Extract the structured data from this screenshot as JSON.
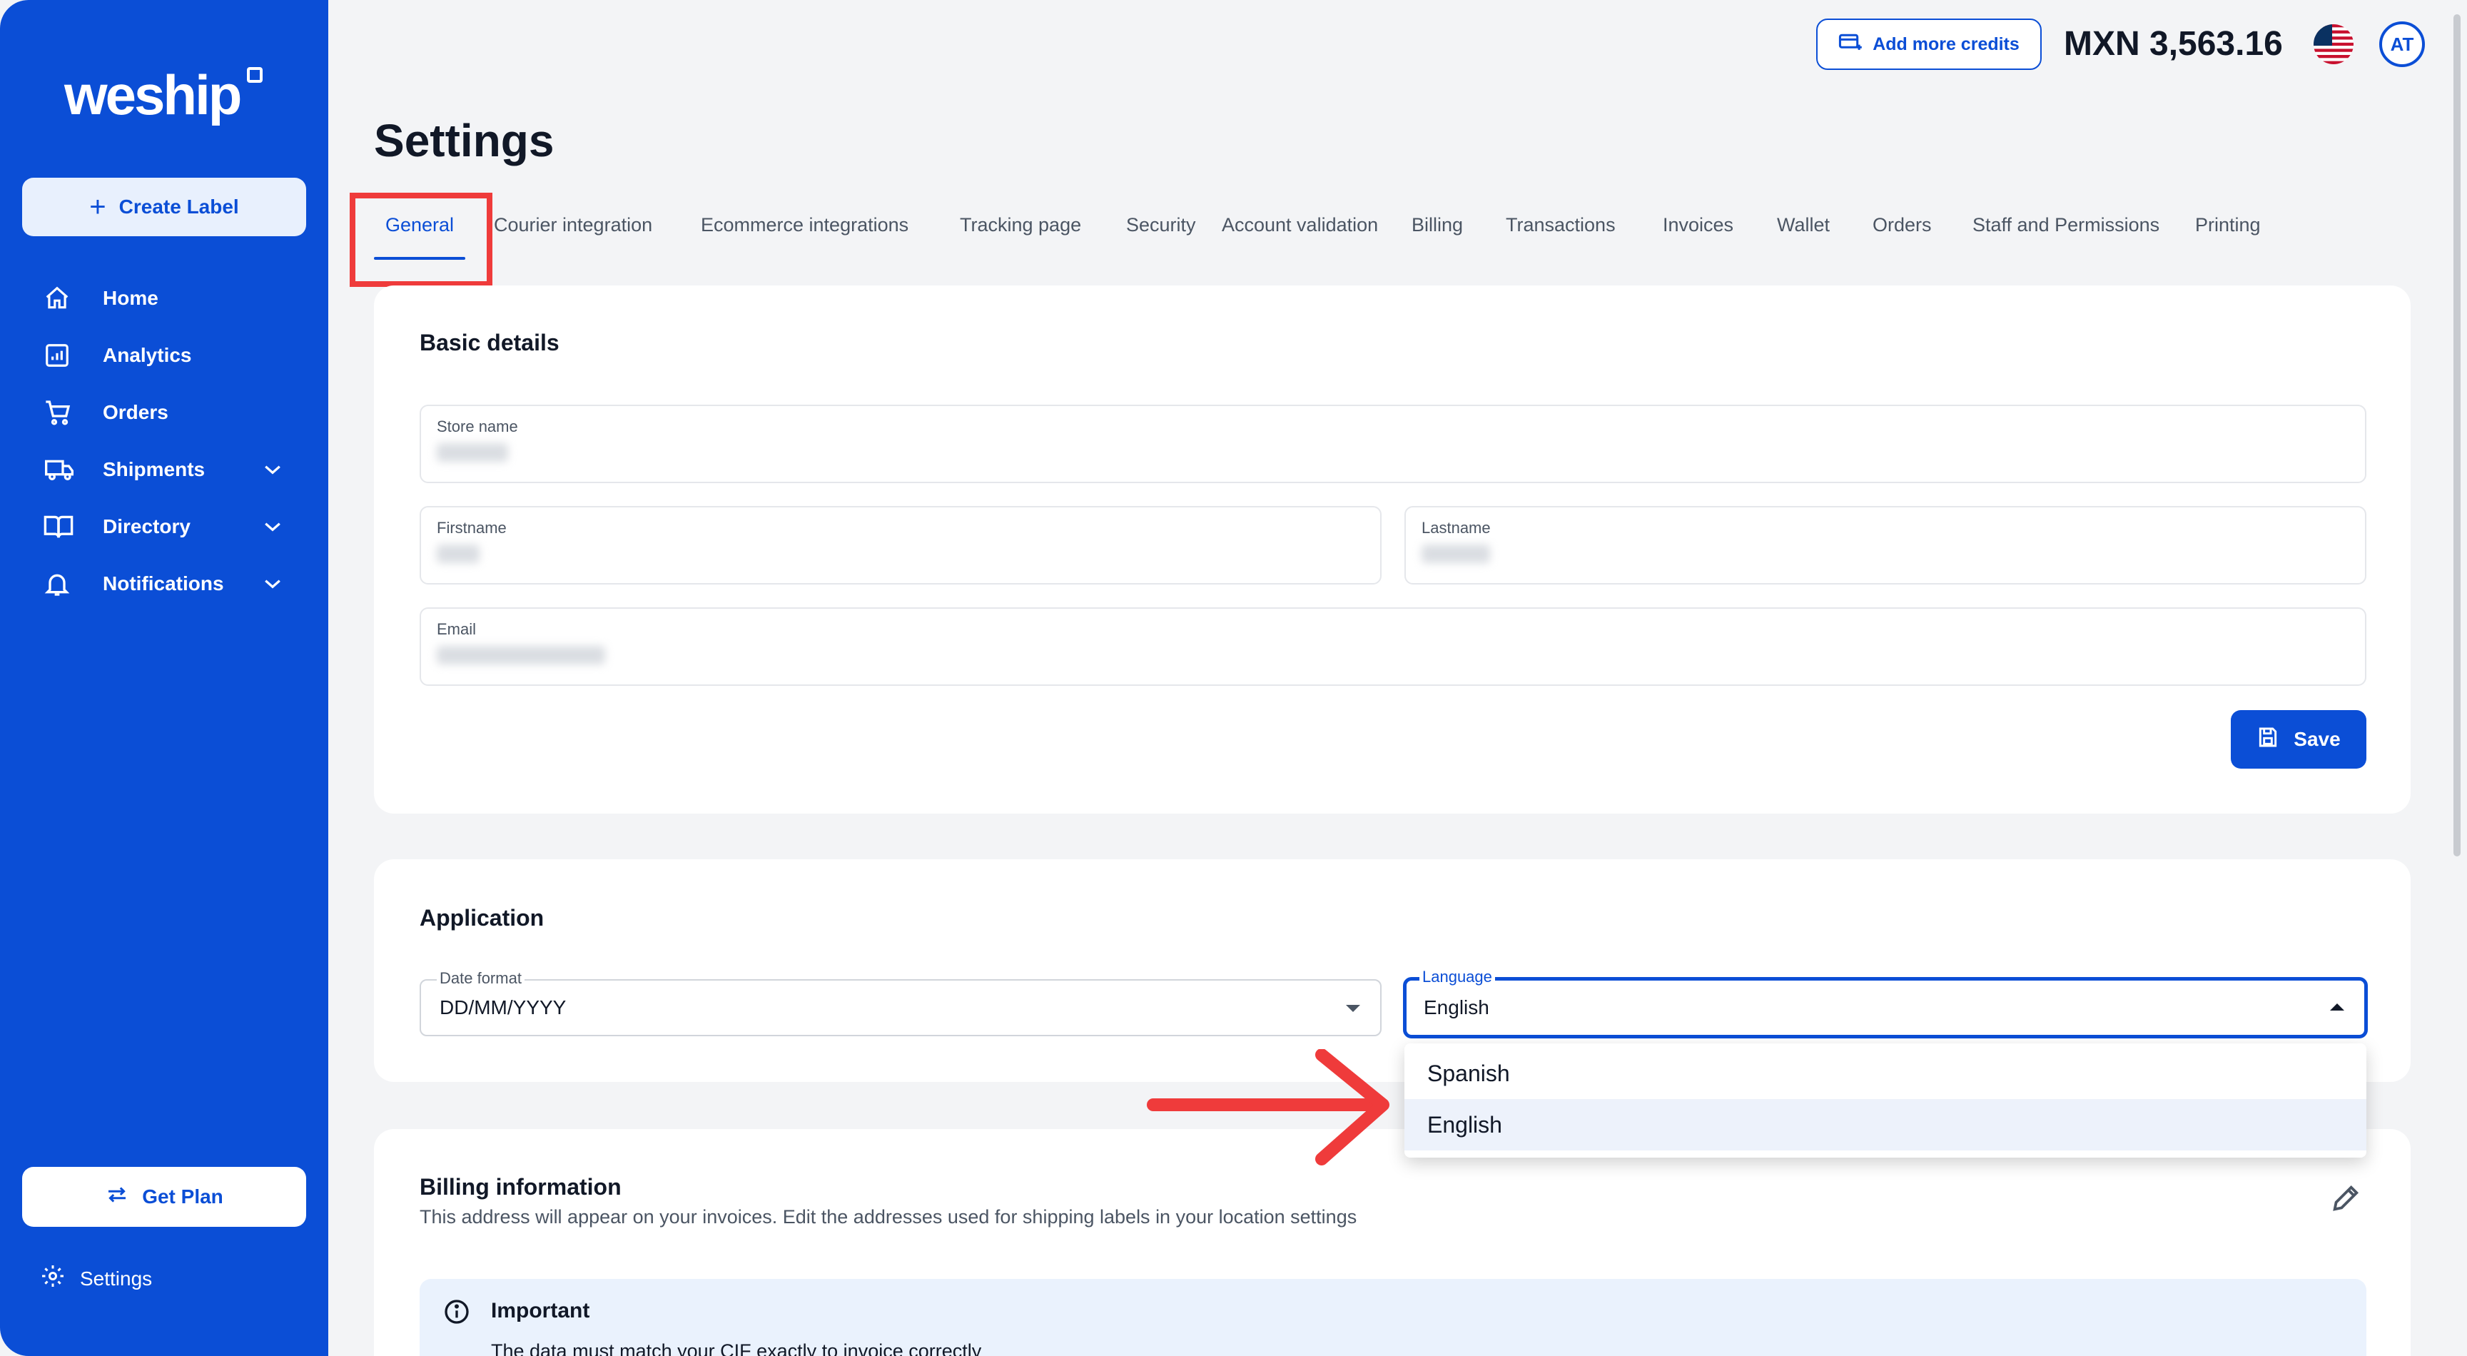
{
  "brand": {
    "name": "weship"
  },
  "sidebar": {
    "create_label": "Create Label",
    "items": [
      {
        "label": "Home",
        "icon": "home-icon"
      },
      {
        "label": "Analytics",
        "icon": "analytics-icon"
      },
      {
        "label": "Orders",
        "icon": "cart-icon"
      },
      {
        "label": "Shipments",
        "icon": "truck-icon",
        "expandable": true
      },
      {
        "label": "Directory",
        "icon": "book-icon",
        "expandable": true
      },
      {
        "label": "Notifications",
        "icon": "bell-icon",
        "expandable": true
      }
    ],
    "get_plan": "Get Plan",
    "settings": "Settings"
  },
  "topbar": {
    "add_credits": "Add more credits",
    "balance": "MXN 3,563.16",
    "avatar_initials": "AT"
  },
  "page": {
    "title": "Settings"
  },
  "tabs": [
    "General",
    "Courier integration",
    "Ecommerce integrations",
    "Tracking page",
    "Security",
    "Account validation",
    "Billing",
    "Transactions",
    "Invoices",
    "Wallet",
    "Orders",
    "Staff and Permissions",
    "Printing"
  ],
  "active_tab": "General",
  "basic_details": {
    "title": "Basic details",
    "store_name_label": "Store name",
    "firstname_label": "Firstname",
    "lastname_label": "Lastname",
    "email_label": "Email",
    "save": "Save"
  },
  "application": {
    "title": "Application",
    "date_format_label": "Date format",
    "date_format_value": "DD/MM/YYYY",
    "language_label": "Language",
    "language_value": "English",
    "language_options": [
      "Spanish",
      "English"
    ],
    "language_selected": "English"
  },
  "billing": {
    "title": "Billing information",
    "subtitle": "This address will appear on your invoices. Edit the addresses used for shipping labels in your location settings",
    "important_title": "Important",
    "important_body": "The data must match your CIF exactly to invoice correctly"
  },
  "colors": {
    "primary": "#0b4ed6",
    "annotation": "#ef3b3b",
    "background": "#f3f4f6"
  }
}
